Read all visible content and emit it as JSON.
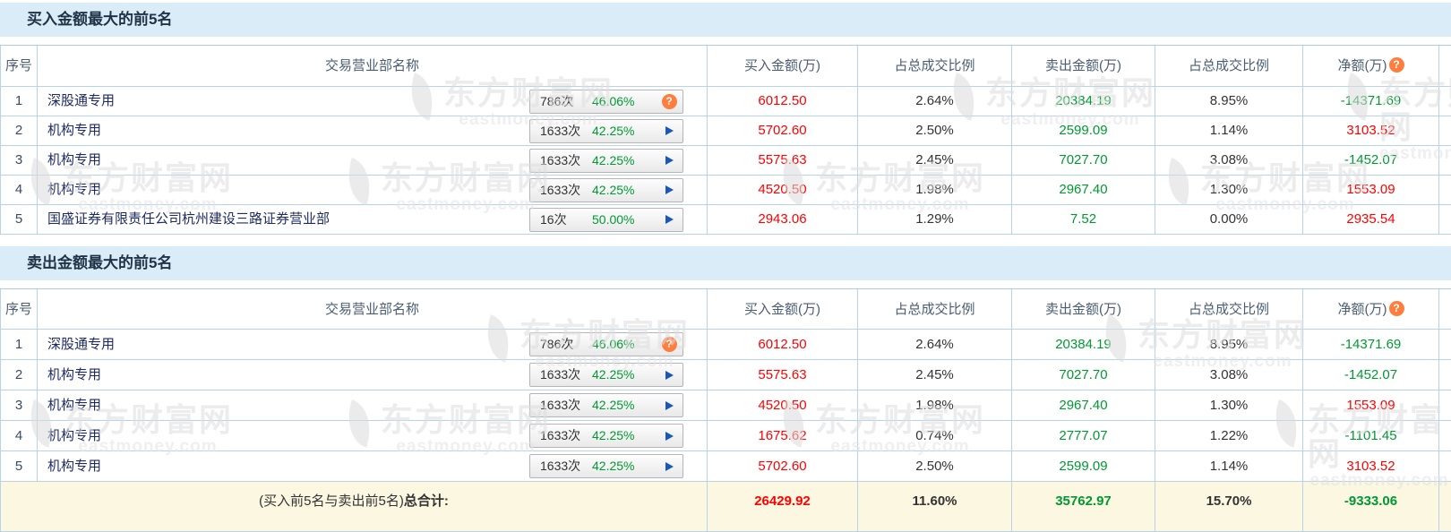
{
  "page": {
    "section1_title": "买入金额最大的前5名",
    "section2_title": "卖出金额最大的前5名",
    "footer_label_normal": "(买入前5名与卖出前5名)",
    "footer_label_bold": "总合计:"
  },
  "watermark": {
    "text": "东方财富网",
    "url": "eastmoney.com"
  },
  "icons": {
    "help": "?",
    "net_help": "?"
  },
  "columns": {
    "seq": "序号",
    "name": "交易营业部名称",
    "buy": "买入金额(万)",
    "buy_pct": "占总成交比例",
    "sell": "卖出金额(万)",
    "sell_pct": "占总成交比例",
    "net": "净额(万)"
  },
  "colors": {
    "red": "#ff0000",
    "green": "#009933"
  },
  "table1": {
    "rows": [
      {
        "seq": "1",
        "name": "深股通专用",
        "badge_count": "786次",
        "badge_pct": "46.06%",
        "buy": "6012.50",
        "buy_pct": "2.64%",
        "sell": "20384.19",
        "sell_pct": "8.95%",
        "net": "-14371.69",
        "net_color": "green"
      },
      {
        "seq": "2",
        "name": "机构专用",
        "badge_count": "1633次",
        "badge_pct": "42.25%",
        "buy": "5702.60",
        "buy_pct": "2.50%",
        "sell": "2599.09",
        "sell_pct": "1.14%",
        "net": "3103.52",
        "net_color": "red"
      },
      {
        "seq": "3",
        "name": "机构专用",
        "badge_count": "1633次",
        "badge_pct": "42.25%",
        "buy": "5575.63",
        "buy_pct": "2.45%",
        "sell": "7027.70",
        "sell_pct": "3.08%",
        "net": "-1452.07",
        "net_color": "green"
      },
      {
        "seq": "4",
        "name": "机构专用",
        "badge_count": "1633次",
        "badge_pct": "42.25%",
        "buy": "4520.50",
        "buy_pct": "1.98%",
        "sell": "2967.40",
        "sell_pct": "1.30%",
        "net": "1553.09",
        "net_color": "red"
      },
      {
        "seq": "5",
        "name": "国盛证券有限责任公司杭州建设三路证券营业部",
        "badge_count": "16次",
        "badge_pct": "50.00%",
        "buy": "2943.06",
        "buy_pct": "1.29%",
        "sell": "7.52",
        "sell_pct": "0.00%",
        "net": "2935.54",
        "net_color": "red"
      }
    ]
  },
  "table2": {
    "rows": [
      {
        "seq": "1",
        "name": "深股通专用",
        "badge_count": "786次",
        "badge_pct": "46.06%",
        "buy": "6012.50",
        "buy_pct": "2.64%",
        "sell": "20384.19",
        "sell_pct": "8.95%",
        "net": "-14371.69",
        "net_color": "green"
      },
      {
        "seq": "2",
        "name": "机构专用",
        "badge_count": "1633次",
        "badge_pct": "42.25%",
        "buy": "5575.63",
        "buy_pct": "2.45%",
        "sell": "7027.70",
        "sell_pct": "3.08%",
        "net": "-1452.07",
        "net_color": "green"
      },
      {
        "seq": "3",
        "name": "机构专用",
        "badge_count": "1633次",
        "badge_pct": "42.25%",
        "buy": "4520.50",
        "buy_pct": "1.98%",
        "sell": "2967.40",
        "sell_pct": "1.30%",
        "net": "1553.09",
        "net_color": "red"
      },
      {
        "seq": "4",
        "name": "机构专用",
        "badge_count": "1633次",
        "badge_pct": "42.25%",
        "buy": "1675.62",
        "buy_pct": "0.74%",
        "sell": "2777.07",
        "sell_pct": "1.22%",
        "net": "-1101.45",
        "net_color": "green"
      },
      {
        "seq": "5",
        "name": "机构专用",
        "badge_count": "1633次",
        "badge_pct": "42.25%",
        "buy": "5702.60",
        "buy_pct": "2.50%",
        "sell": "2599.09",
        "sell_pct": "1.14%",
        "net": "3103.52",
        "net_color": "red"
      }
    ]
  },
  "totals": {
    "buy": "26429.92",
    "buy_pct": "11.60%",
    "sell": "35762.97",
    "sell_pct": "15.70%",
    "net": "-9333.06",
    "net_color": "green"
  }
}
